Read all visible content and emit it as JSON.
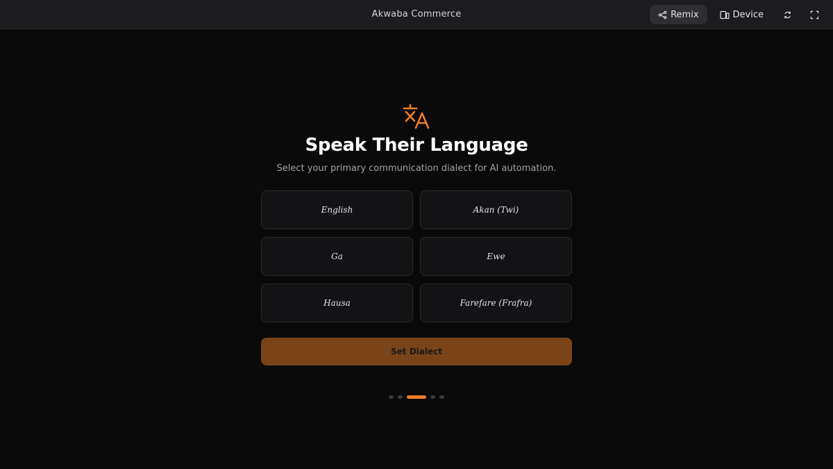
{
  "app": {
    "title": "Akwaba Commerce"
  },
  "toolbar": {
    "remix_label": "Remix",
    "device_label": "Device",
    "remix_icon": "share-nodes-icon",
    "device_icon": "devices-icon",
    "refresh_icon": "refresh-icon",
    "fullscreen_icon": "fullscreen-icon"
  },
  "onboarding": {
    "icon": "translate-icon",
    "title": "Speak Their Language",
    "subtitle": "Select your primary communication dialect for AI automation.",
    "options": [
      {
        "label": "English"
      },
      {
        "label": "Akan (Twi)"
      },
      {
        "label": "Ga"
      },
      {
        "label": "Ewe"
      },
      {
        "label": "Hausa"
      },
      {
        "label": "Farefare (Frafra)"
      }
    ],
    "submit_label": "Set Dialect",
    "progress": {
      "total_steps": 5,
      "current_step": 3
    }
  },
  "colors": {
    "accent": "#f07d2b",
    "button_bg": "#7a4418",
    "background": "#0a0a0b",
    "topbar_bg": "#1c1c1e"
  }
}
